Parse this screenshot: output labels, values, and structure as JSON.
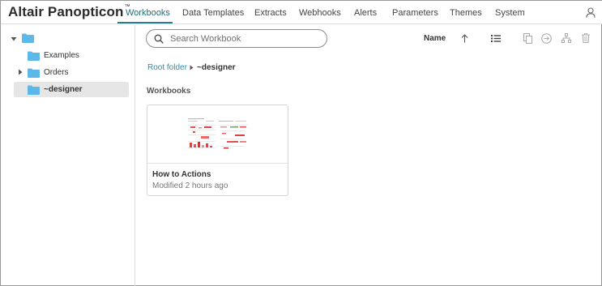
{
  "app": {
    "brand": "Altair Panopticon",
    "brand_mark": "™"
  },
  "nav": {
    "tabs": [
      {
        "label": "Workbooks",
        "active": true
      },
      {
        "label": "Data Templates"
      },
      {
        "label": "Extracts"
      },
      {
        "label": "Webhooks"
      },
      {
        "label": "Alerts"
      },
      {
        "label": "Parameters"
      },
      {
        "label": "Themes"
      },
      {
        "label": "System"
      }
    ],
    "user_icon": "user-icon"
  },
  "sidebar": {
    "tree": [
      {
        "label": "",
        "icon": "folder-icon",
        "expanded": true
      },
      {
        "label": "Examples",
        "icon": "folder-icon"
      },
      {
        "label": "Orders",
        "icon": "folder-icon",
        "expanded": false
      },
      {
        "label": "~designer",
        "icon": "folder-icon",
        "selected": true
      }
    ]
  },
  "toolbar": {
    "search_placeholder": "Search Workbook",
    "sort_label": "Name",
    "icons": [
      "search-icon",
      "sort-ascending-icon",
      "list-view-icon",
      "copy-icon",
      "move-icon",
      "hierarchy-icon",
      "trash-icon"
    ]
  },
  "breadcrumb": {
    "root": "Root folder",
    "current": "~designer"
  },
  "section": {
    "title": "Workbooks"
  },
  "workbooks": [
    {
      "title": "How to Actions",
      "modified": "Modified 2 hours ago"
    }
  ],
  "colors": {
    "accent": "#2a7f8c",
    "link": "#2a8fb0",
    "folder": "#5bb8e8",
    "selected_bg": "#e6e6e6"
  }
}
